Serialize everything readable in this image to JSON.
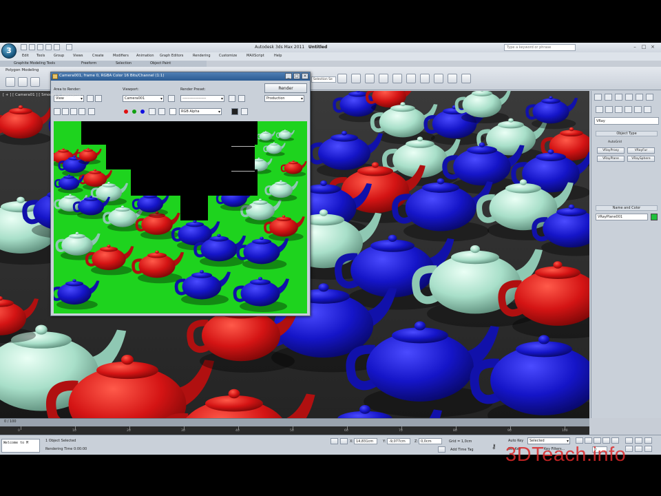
{
  "app": {
    "logo_glyph": "3",
    "title_prefix": "Autodesk 3ds Max 2011",
    "title_doc": "Untitled",
    "help_search_placeholder": "Type a keyword or phrase",
    "controls": [
      "–",
      "□",
      "×"
    ]
  },
  "menubar": [
    "Edit",
    "Tools",
    "Group",
    "Views",
    "Create",
    "Modifiers",
    "Animation",
    "Graph Editors",
    "Rendering",
    "Customize",
    "MAXScript",
    "Help"
  ],
  "ribbon": {
    "tabs": [
      "Graphite Modeling Tools",
      "Freeform",
      "Selection",
      "Object Paint"
    ],
    "panel_label": "Polygon Modeling",
    "selection_filter": "Selection Se"
  },
  "viewport": {
    "label": "[ + ] [ Camera01 ] [ Smooth + Highlights ]"
  },
  "render_window": {
    "title": "Camera001, frame 0, RGBA Color 16 Bits/Channel (1:1)",
    "area_label": "Area to Render:",
    "area_value": "View",
    "viewport_label": "Viewport:",
    "viewport_value": "Camera001",
    "preset_label": "Render Preset:",
    "preset_value": "-------------------",
    "render_button": "Render",
    "mode_value": "Production",
    "channel_value": "RGB Alpha",
    "controls": [
      "_",
      "□",
      "×"
    ]
  },
  "command_panel": {
    "dropdown": "VRay",
    "object_type_header": "Object Type",
    "autogrid_label": "AutoGrid",
    "buttons": [
      "VRayProxy",
      "VRayFur",
      "VRayPlane",
      "VRaySphere"
    ],
    "name_color_header": "Name and Color",
    "name_value": "VRayPlane001",
    "swatch_color": "#1fbf3a"
  },
  "timeline": {
    "readout": "0 / 100",
    "ticks": [
      "0",
      "10",
      "20",
      "30",
      "40",
      "50",
      "60",
      "70",
      "80",
      "90",
      "100"
    ]
  },
  "status": {
    "maxscript_text": "Welcome to M",
    "selected_text": "1 Object Selected",
    "render_time": "Rendering Time  0:00:00",
    "x_label": "X:",
    "x_value": "14,831cm",
    "y_label": "Y:",
    "y_value": "-9,077cm",
    "z_label": "Z:",
    "z_value": "0,0cm",
    "grid_text": "Grid = 1,0cm",
    "autokey_label": "Auto Key",
    "autokey_value": "Selected",
    "setkey_label": "Set Key",
    "keyfilters_label": "Key Filters...",
    "add_time_tag": "Add Time Tag",
    "frame_value": "0"
  },
  "watermark": "3DTeach.info",
  "colors": {
    "teapot_red": "#d41414",
    "teapot_blue": "#1515c8",
    "teapot_cyan": "#a8dfc9",
    "render_bg_green": "#1ed31e",
    "title_blue": "#2a5a92"
  }
}
